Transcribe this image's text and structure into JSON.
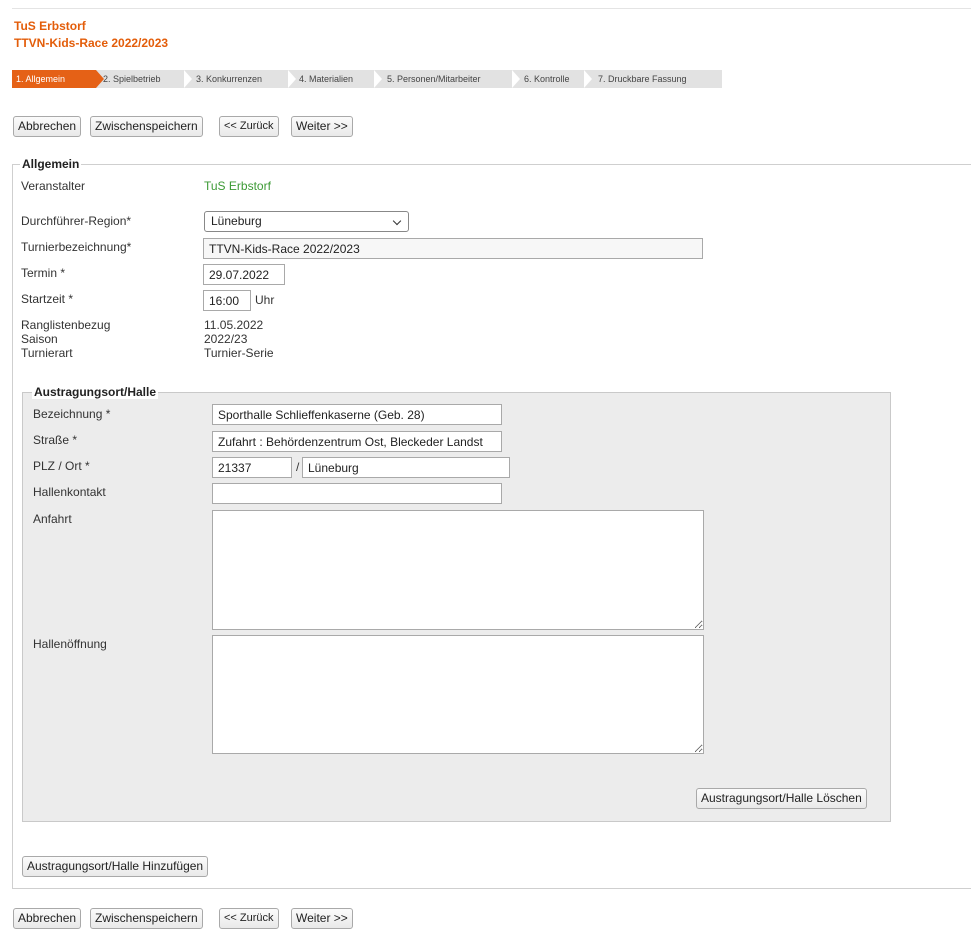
{
  "header": {
    "club": "TuS Erbstorf",
    "event": "TTVN-Kids-Race 2022/2023"
  },
  "steps": [
    {
      "label": "1. Allgemein"
    },
    {
      "label": "2. Spielbetrieb"
    },
    {
      "label": "3. Konkurrenzen"
    },
    {
      "label": "4. Materialien"
    },
    {
      "label": "5. Personen/Mitarbeiter"
    },
    {
      "label": "6. Kontrolle"
    },
    {
      "label": "7. Druckbare Fassung"
    }
  ],
  "toolbar": {
    "cancel": "Abbrechen",
    "save": "Zwischenspeichern",
    "back": "<< Zurück",
    "next": "Weiter >>"
  },
  "general": {
    "legend": "Allgemein",
    "organizer_label": "Veranstalter",
    "organizer_value": "TuS Erbstorf",
    "region_label": "Durchführer-Region*",
    "region_value": "Lüneburg",
    "name_label": "Turnierbezeichnung*",
    "name_value": "TTVN-Kids-Race 2022/2023",
    "date_label": "Termin *",
    "date_value": "29.07.2022",
    "start_label": "Startzeit *",
    "start_value": "16:00",
    "start_unit": "Uhr",
    "rank_label": "Ranglistenbezug",
    "rank_value": "11.05.2022",
    "season_label": "Saison",
    "season_value": "2022/23",
    "type_label": "Turnierart",
    "type_value": "Turnier-Serie"
  },
  "venue": {
    "legend": "Austragungsort/Halle",
    "name_label": "Bezeichnung *",
    "name_value": "Sporthalle Schlieffenkaserne (Geb. 28)",
    "street_label": "Straße *",
    "street_value": "Zufahrt : Behördenzentrum Ost, Bleckeder Landst",
    "zip_label": "PLZ / Ort *",
    "zip_value": "21337",
    "city_value": "Lüneburg",
    "zip_sep": "/",
    "contact_label": "Hallenkontakt",
    "contact_value": "",
    "directions_label": "Anfahrt",
    "opening_label": "Hallenöffnung",
    "delete_button": "Austragungsort/Halle Löschen"
  },
  "add_venue_button": "Austragungsort/Halle Hinzufügen"
}
